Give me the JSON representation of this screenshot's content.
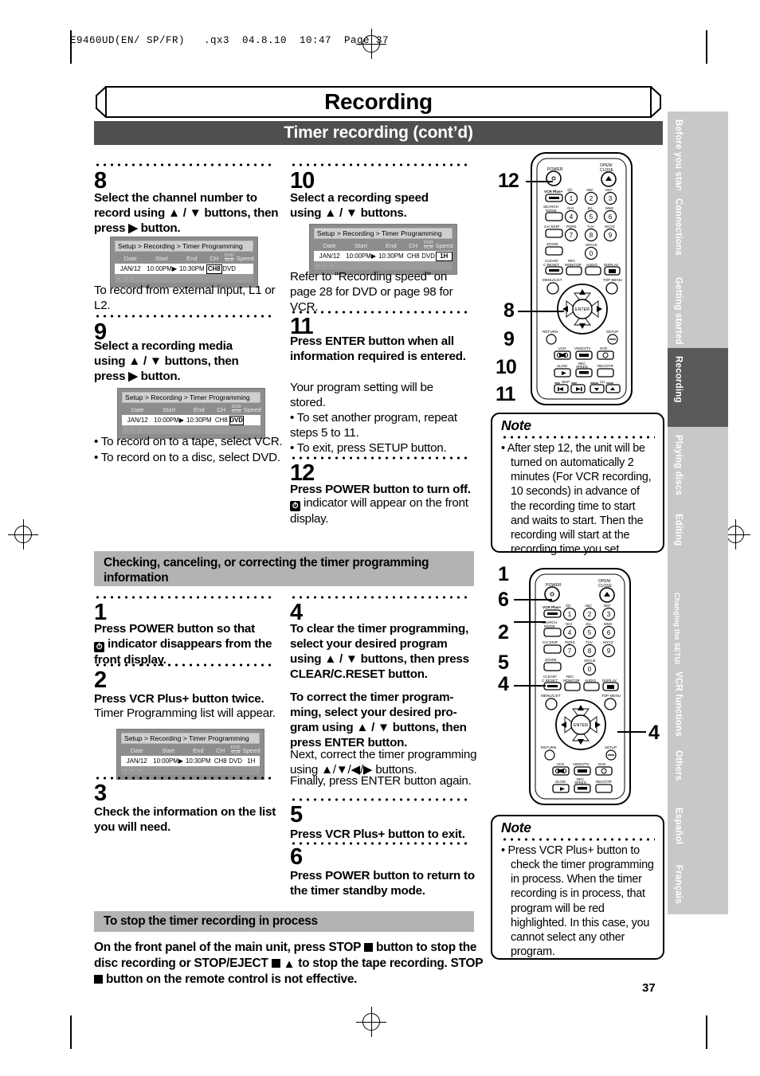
{
  "print_header": "E9460UD(EN/ SP/FR)   .qx3  04.8.10  10:47  Page 37",
  "page_title": "Recording",
  "page_subtitle": "Timer recording (cont’d)",
  "page_number": "37",
  "osd": {
    "breadcrumb": "Setup > Recording > Timer Programming",
    "columns": [
      "Date",
      "Start",
      "End",
      "CH",
      "DVD/VCR",
      "Speed"
    ],
    "row": {
      "date": "JAN/12",
      "start": "10:00PM",
      "end": "10:30PM",
      "ch": "CH8",
      "media": "DVD",
      "speed": "1H"
    },
    "empty_row": "- - -"
  },
  "steps_main": [
    {
      "num": "8",
      "bold": "Select the channel number to record using ▲ / ▼ buttons, then press ▶ button.",
      "after": "To record from external input, L1 or L2.",
      "highlight": "ch",
      "osd_speed_visible": false
    },
    {
      "num": "9",
      "bold": "Select a recording media using ▲ / ▼ buttons, then press ▶ button.",
      "bullets": [
        "• To record on to a tape, select VCR.",
        "• To record on to a disc, select DVD."
      ],
      "highlight": "media",
      "osd_speed_visible": false
    },
    {
      "num": "10",
      "bold": "Select a recording speed using ▲ / ▼ buttons.",
      "after": "Refer to “Recording speed” on page 28 for DVD or page 98 for VCR.",
      "highlight": "speed",
      "osd_speed_visible": true
    },
    {
      "num": "11",
      "bold": "Press ENTER button when all information required is entered.",
      "after": "Your program setting will be stored.",
      "bullets": [
        "• To set another program, repeat",
        "   steps 5 to 11.",
        "• To exit, press SETUP button."
      ]
    },
    {
      "num": "12",
      "bold": "Press POWER button to turn off.",
      "after_icon": "indicator will appear on the front display."
    }
  ],
  "section2": {
    "header": "Checking, canceling, or correcting the timer programming information",
    "steps": [
      {
        "num": "1",
        "bold_pre": "Press POWER button so that",
        "bold_post": "indicator disappears from the front display."
      },
      {
        "num": "2",
        "bold": "Press VCR Plus+ button twice.",
        "after": "Timer Programming list will appear."
      },
      {
        "num": "3",
        "bold": "Check the information on the list you will need."
      },
      {
        "num": "4",
        "bold": "To clear the timer programming, select your desired program using ▲ / ▼ buttons, then press CLEAR/C.RESET button.",
        "bold2": "To correct the timer program-ming, select your desired pro-gram using ▲ / ▼ buttons, then press ENTER button.",
        "after": "Next, correct the timer programming using ▲/▼/◀/▶ buttons.",
        "after2": "Finally, press ENTER button again."
      },
      {
        "num": "5",
        "bold": "Press VCR Plus+ button to exit."
      },
      {
        "num": "6",
        "bold": "Press POWER button to return to the timer standby mode."
      }
    ]
  },
  "section3": {
    "header": "To stop the timer recording in process",
    "lines": [
      "On the front panel of the main unit, press STOP",
      "button to stop the disc recording or STOP/EJECT",
      "to stop the tape recording. STOP",
      "button on the remote control is not effective."
    ]
  },
  "notes": [
    {
      "title": "Note",
      "body": "• After step 12, the unit will be turned on automatically 2 minutes (For VCR recording, 10 seconds) in advance of the recording time to start and waits to start. Then the recording will start at the recording time you set."
    },
    {
      "title": "Note",
      "body": "• Press VCR Plus+ button to check the timer programming in process. When the timer recording is in process, that program will be red highlighted. In this case, you cannot select any other program."
    }
  ],
  "remote_labels": {
    "power": "POWER",
    "open_close": "OPEN/\nCLOSE",
    "vcr_plus": "VCR Plus+",
    "search_mode": "SEARCH\nMODE",
    "ch_skip": "CH SKIP",
    "zoom": "ZOOM",
    "clear_reset": "CLEAR/\nC.RESET",
    "rec_monitor": "REC\nMONITOR",
    "audio": "AUDIO",
    "display": "DISPLAY",
    "menu_list": "MENU/LIST",
    "top_menu": "TOP MENU",
    "enter": "ENTER",
    "return": "RETURN",
    "setup": "SETUP",
    "vcr": "VCR",
    "video_tv": "VIDEO/TV",
    "dvd": "DVD",
    "slow": "SLOW",
    "rec_speed": "REC\nSPEED",
    "rec_otr": "REC/OTR",
    "skip": "SKIP",
    "ch": "CH",
    "keypad_letters": [
      ".@/:",
      "ABC",
      "DEF",
      "GHI",
      "JKL",
      "MNO",
      "PQRS",
      "TUV",
      "WXYZ",
      "SPACE"
    ],
    "keypad_digits": [
      "1",
      "2",
      "3",
      "4",
      "5",
      "6",
      "7",
      "8",
      "9",
      "0"
    ]
  },
  "callouts_remote1": [
    "12",
    "8",
    "9",
    "10",
    "11"
  ],
  "callouts_remote2": [
    "1",
    "6",
    "2",
    "5",
    "4",
    "4"
  ],
  "side_tabs": [
    {
      "label": "Before you start",
      "active": false,
      "small": false
    },
    {
      "label": "Connections",
      "active": false,
      "small": false
    },
    {
      "label": "Getting started",
      "active": false,
      "small": false
    },
    {
      "label": "Recording",
      "active": true,
      "small": false
    },
    {
      "label": "Playing discs",
      "active": false,
      "small": false
    },
    {
      "label": "Editing",
      "active": false,
      "small": false
    },
    {
      "label": "Changing the SETUP menu",
      "active": false,
      "small": true
    },
    {
      "label": "VCR functions",
      "active": false,
      "small": false
    },
    {
      "label": "Others",
      "active": false,
      "small": false
    },
    {
      "label": "Español",
      "active": false,
      "small": false
    },
    {
      "label": "Français",
      "active": false,
      "small": false
    }
  ]
}
